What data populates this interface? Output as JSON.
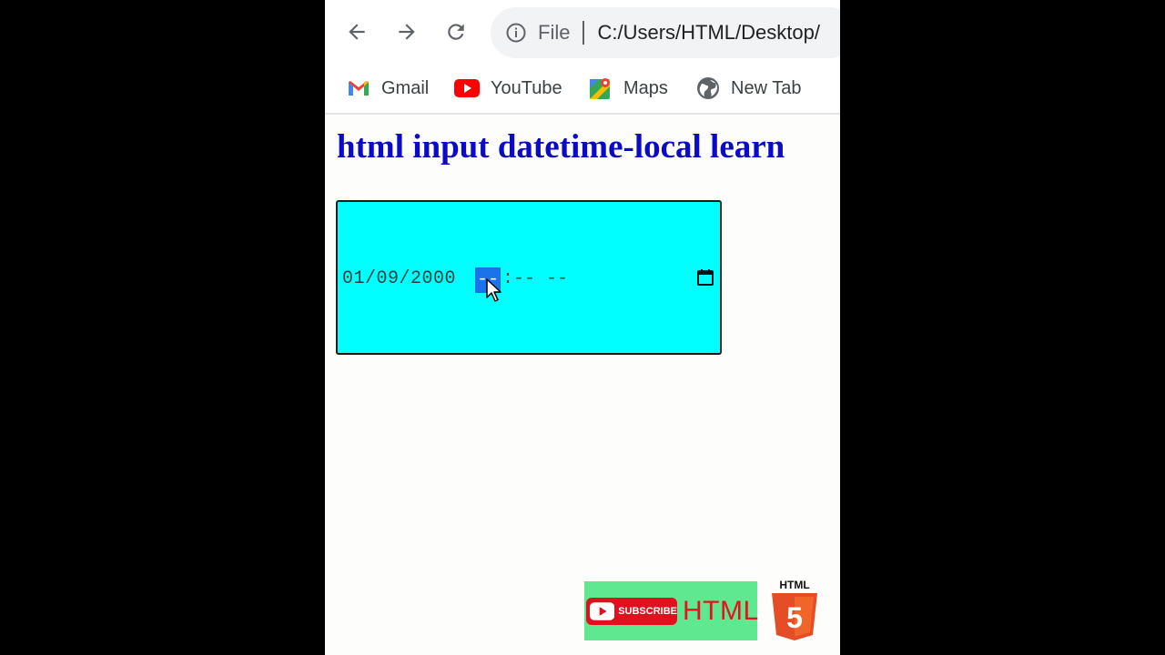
{
  "browser": {
    "url_scheme": "File",
    "url": "C:/Users/HTML/Desktop/"
  },
  "bookmarks": [
    {
      "label": "Gmail",
      "icon": "gmail-icon"
    },
    {
      "label": "YouTube",
      "icon": "youtube-icon"
    },
    {
      "label": "Maps",
      "icon": "maps-icon"
    },
    {
      "label": "New Tab",
      "icon": "globe-icon"
    }
  ],
  "page": {
    "title": "html input datetime-local learn"
  },
  "datetime_input": {
    "date_value": "01/09/2000",
    "hour_placeholder": "--",
    "rest_placeholder": ":-- --",
    "background": "#00ffff"
  },
  "overlay": {
    "subscribe_label": "SUBSCRIBE",
    "channel_text": "HTML",
    "badge_text": "HTML",
    "badge_number": "5"
  }
}
